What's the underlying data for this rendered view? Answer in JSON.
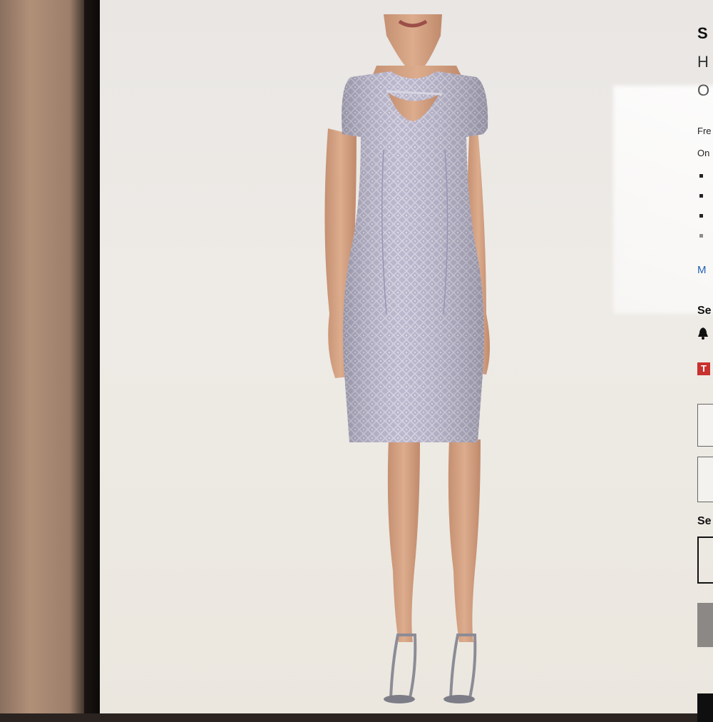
{
  "product": {
    "brand_initial": "S",
    "name_initial": "H",
    "price_initial": "O",
    "shipping_text": "Fre",
    "online_text": "On",
    "more_link": "M",
    "section1_label": "Se",
    "badge_letter": "T",
    "section2_label": "Se"
  },
  "colors": {
    "dress": "#b4b0c8",
    "accent_red": "#c8312e",
    "link_blue": "#1f62b3"
  }
}
